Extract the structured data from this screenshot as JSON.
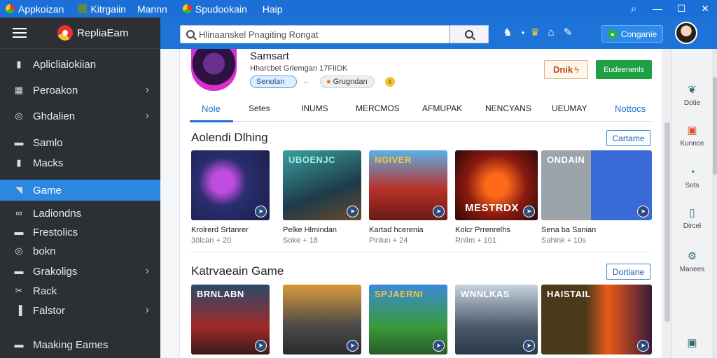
{
  "titlebar": {
    "tabs": [
      {
        "label": "Appkoizan"
      },
      {
        "label": "Kitrgaiin"
      },
      {
        "label": "Mannn"
      },
      {
        "label": "Spudookain"
      },
      {
        "label": "Haip"
      }
    ],
    "controls": [
      "⌕",
      "—",
      "☐",
      "✕"
    ]
  },
  "sidebar": {
    "app_name": "RepliaEam",
    "items": [
      {
        "label": "Aplicliaiokiian",
        "icon": "square-icon",
        "chev": ""
      },
      {
        "label": "Peroakon",
        "icon": "grid-icon",
        "chev": "›"
      },
      {
        "label": "Ghdalien",
        "icon": "circle-icon",
        "chev": "›"
      },
      {
        "label": "Samlo",
        "icon": "folder-icon",
        "chev": ""
      },
      {
        "label": "Macks",
        "icon": "square-icon",
        "chev": ""
      },
      {
        "label": "Game",
        "icon": "gamepad-icon",
        "chev": ""
      },
      {
        "label": "Ladiondns",
        "icon": "link-icon",
        "chev": ""
      },
      {
        "label": "Frestolics",
        "icon": "folder-icon",
        "chev": ""
      },
      {
        "label": "bokn",
        "icon": "circle-icon",
        "chev": ""
      },
      {
        "label": "Grakoligs",
        "icon": "folder-icon",
        "chev": "›"
      },
      {
        "label": "Rack",
        "icon": "tools-icon",
        "chev": ""
      },
      {
        "label": "Falstor",
        "icon": "bar-icon",
        "chev": "›"
      },
      {
        "label": "Maaking Eames",
        "icon": "folder-icon",
        "chev": ""
      }
    ]
  },
  "topbar": {
    "search_placeholder": "Hlinaanskel Pnagiting Rongat",
    "connect_label": "Conganie"
  },
  "app": {
    "name": "Samsart",
    "meta": "Hharcbet Grlemgan  17FIIDK",
    "chip1": "Senolan",
    "chip_dots": "..",
    "chip2": "Grugndan",
    "button1": "Dnik",
    "button2": "Eudeenenls"
  },
  "tabs": [
    "Nole",
    "Setes",
    "INUMS",
    "MERCMOS",
    "AFMUPAK",
    "NENCYANS",
    "UEUMAY",
    "Nottocs"
  ],
  "section1": {
    "title": "Aolendi Dlhing",
    "button": "Cartame",
    "cards": [
      {
        "name": "Krolrerd Srtanrer",
        "meta": "3ölcan + 20",
        "overlay": ""
      },
      {
        "name": "Pelke Hlmindan",
        "meta": "Soke + 18",
        "overlay": "UBOENJC"
      },
      {
        "name": "Kartad hcerenia",
        "meta": "Pinlun + 24",
        "overlay": "NGIVER"
      },
      {
        "name": "Kolcr Prrenrelhs",
        "meta": "Rnlim + 101",
        "overlay": "MESTRDX"
      },
      {
        "name": "Sena ba Sanian",
        "meta": "Sahink + 10s",
        "overlay": "ONDAIN"
      }
    ]
  },
  "section2": {
    "title": "Katrvaeain Game",
    "button": "Dortiane",
    "cards": [
      {
        "overlay": "BRNLABN"
      },
      {
        "overlay": ""
      },
      {
        "overlay": "SPJAERNI"
      },
      {
        "overlay": "WNNLKAS"
      },
      {
        "overlay": "HAISTAIL"
      }
    ]
  },
  "rightbar": {
    "items": [
      {
        "label": "Dotie",
        "icon": "leaf-icon"
      },
      {
        "label": "Kunnce",
        "icon": "window-icon"
      },
      {
        "label": "Sots",
        "icon": "clock-icon"
      },
      {
        "label": "Dircel",
        "icon": "document-icon"
      },
      {
        "label": "Manees",
        "icon": "gear-icon"
      },
      {
        "label": "",
        "icon": "window-icon"
      }
    ]
  },
  "colors": {
    "brand_blue": "#1d73d8",
    "sidebar_bg": "#2c2f33",
    "active_item": "#2b87e0",
    "accent_green": "#1fa045"
  }
}
